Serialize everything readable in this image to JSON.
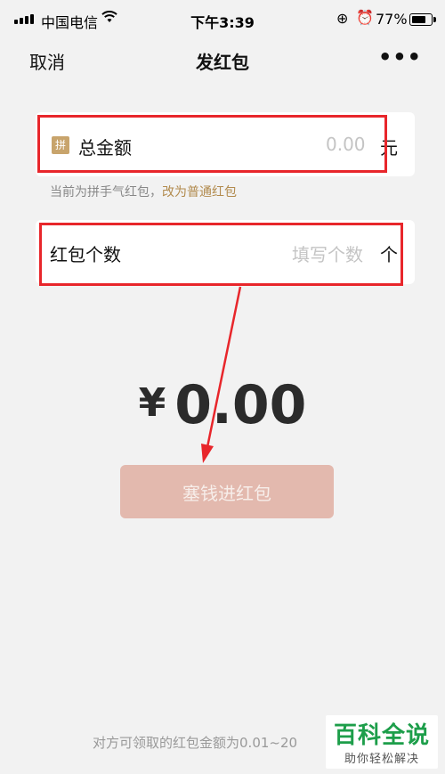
{
  "status": {
    "carrier": "中国电信",
    "time": "下午3:39",
    "battery_percent": "77%",
    "battery_level": 0.77
  },
  "nav": {
    "cancel": "取消",
    "title": "发红包",
    "more": "•••"
  },
  "amount_field": {
    "badge": "拼",
    "label": "总金额",
    "placeholder": "0.00",
    "unit": "元"
  },
  "hint": {
    "text": "当前为拼手气红包，",
    "link": "改为普通红包"
  },
  "count_field": {
    "label": "红包个数",
    "placeholder": "填写个数",
    "unit": "个"
  },
  "total": {
    "currency": "¥",
    "value": "0.00"
  },
  "submit_label": "塞钱进红包",
  "footer_note": "对方可领取的红包金额为0.01~20",
  "watermark": {
    "title": "百科全说",
    "subtitle": "助你轻松解决"
  },
  "colors": {
    "accent_gold": "#c8a46c",
    "button_disabled": "#e3b9ae",
    "annotation_red": "#e8262b"
  }
}
